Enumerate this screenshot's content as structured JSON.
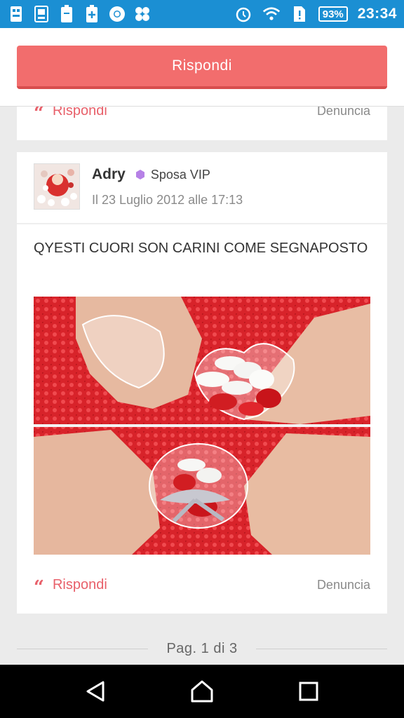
{
  "status_bar": {
    "battery": "93%",
    "time": "23:34",
    "left_icons": [
      "sim-icon",
      "image-icon",
      "battery-saver-icon",
      "plus-icon",
      "chrome-icon",
      "flower-icon"
    ],
    "right_icons": [
      "alarm-icon",
      "wifi-icon",
      "sim-card-icon"
    ]
  },
  "header": {
    "reply_button": "Rispondi",
    "colors": {
      "accent": "#f26d6d",
      "accent_dark": "#d84d4d",
      "statusbar": "#1b8fd3"
    }
  },
  "previous_post": {
    "reply_label": "Rispondi",
    "report_label": "Denuncia"
  },
  "post": {
    "author": "Adry",
    "badge_icon": "hexagon-icon",
    "badge": "Sposa VIP",
    "date": "Il 23 Luglio 2012 alle 17:13",
    "text": "QYESTI CUORI SON CARINI COME SEGNAPOSTO",
    "reply_label": "Rispondi",
    "report_label": "Denuncia"
  },
  "pager": {
    "label": "Pag. 1 di 3"
  },
  "nav_bar": {
    "buttons": [
      "back-icon",
      "home-icon",
      "recents-icon"
    ]
  }
}
